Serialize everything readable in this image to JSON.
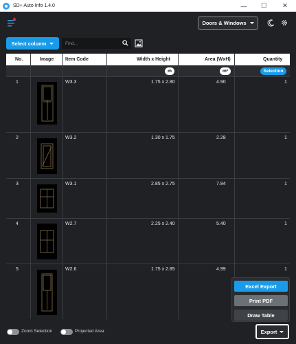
{
  "window": {
    "title": "SD+ Auto Info 1.4.0",
    "minimize": "—",
    "maximize": "☐",
    "close": "✕"
  },
  "header": {
    "category_dropdown": "Doors & Windows",
    "theme_icon": "moon-icon",
    "settings_icon": "gear-icon"
  },
  "toolbar": {
    "select_column_label": "Select column",
    "search_placeholder": "Find...",
    "search_value": ""
  },
  "table": {
    "columns": [
      "No.",
      "Image",
      "Item Code",
      "Width x Height",
      "Area (WxH)",
      "Quantity"
    ],
    "filters": {
      "width_height_unit": "m",
      "area_unit": "m²",
      "quantity_filter": "Selection"
    },
    "rows": [
      {
        "no": "1",
        "code": "W3.3",
        "size": "1.75 x 2.80",
        "area": "4.90",
        "qty": "1"
      },
      {
        "no": "2",
        "code": "W3.2",
        "size": "1.30 x 1.75",
        "area": "2.28",
        "qty": "1"
      },
      {
        "no": "3",
        "code": "W3.1",
        "size": "2.85 x 2.75",
        "area": "7.84",
        "qty": "1"
      },
      {
        "no": "4",
        "code": "W2.7",
        "size": "2.25 x 2.40",
        "area": "5.40",
        "qty": "1"
      },
      {
        "no": "5",
        "code": "W2.6",
        "size": "1.75 x 2.85",
        "area": "4.99",
        "qty": "1"
      }
    ]
  },
  "export_menu": {
    "excel": "Excel Export",
    "pdf": "Print PDF",
    "draw": "Draw Table"
  },
  "footer": {
    "zoom_selection": "Zoom Selection",
    "projected_area": "Projected Area",
    "export_label": "Export"
  },
  "colors": {
    "accent": "#1a9bea",
    "background": "#1f2124",
    "panel": "#2a2c2f"
  }
}
